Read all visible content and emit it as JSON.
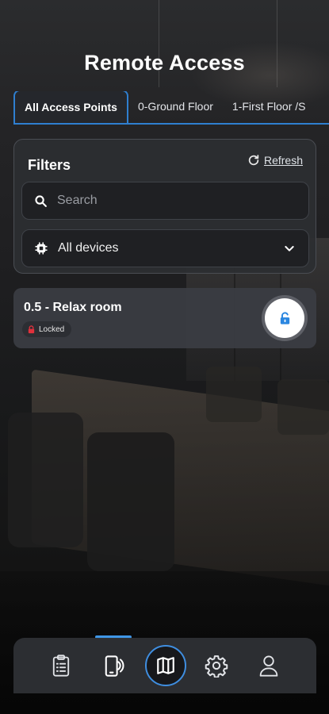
{
  "header": {
    "title": "Remote Access"
  },
  "tabs": [
    {
      "label": "All Access Points",
      "active": true
    },
    {
      "label": "0-Ground Floor",
      "active": false
    },
    {
      "label": "1-First Floor /S",
      "active": false
    }
  ],
  "filters": {
    "title": "Filters",
    "refresh_label": "Refresh",
    "search_placeholder": "Search",
    "device_select_value": "All devices"
  },
  "access_points": [
    {
      "name": "0.5 - Relax room",
      "status": "Locked",
      "status_color": "#e0313c",
      "action_icon": "unlock-icon"
    }
  ],
  "bottom_nav": {
    "items": [
      {
        "icon": "clipboard-list-icon",
        "active": false
      },
      {
        "icon": "phone-nfc-icon",
        "active": true
      },
      {
        "icon": "map-icon",
        "active": false
      },
      {
        "icon": "gear-icon",
        "active": false
      },
      {
        "icon": "user-icon",
        "active": false
      }
    ],
    "accent": "#3f96e6"
  }
}
